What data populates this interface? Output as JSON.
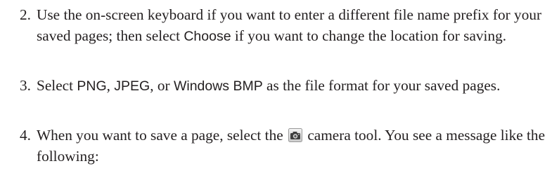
{
  "steps": [
    {
      "number": "2.",
      "parts": [
        "Use the on-screen keyboard if you want to enter a different file name prefix for your saved pages; then select ",
        "Choose",
        " if you want to change the location for saving."
      ]
    },
    {
      "number": "3.",
      "parts": [
        "Select ",
        "PNG",
        ", ",
        "JPEG",
        ", or ",
        "Windows BMP",
        " as the file format for your saved pages."
      ]
    },
    {
      "number": "4.",
      "parts": [
        "When you want to save a page, select the ",
        " camera tool. You see a message like the following:"
      ],
      "icon": "camera-icon"
    }
  ]
}
